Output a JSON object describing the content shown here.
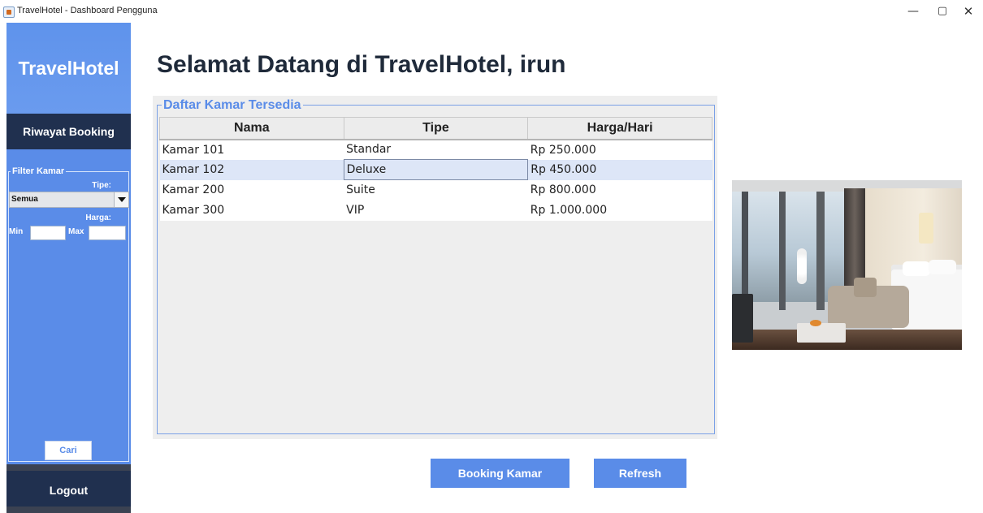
{
  "window": {
    "title": "TravelHotel - Dashboard Pengguna",
    "controls": {
      "minimize": "—",
      "maximize": "▢",
      "close": "✕"
    }
  },
  "sidebar": {
    "brand": "TravelHotel",
    "riwayat_label": "Riwayat Booking",
    "filter": {
      "legend": "Filter Kamar",
      "tipe_label": "Tipe:",
      "tipe_value": "Semua",
      "harga_label": "Harga:",
      "min_label": "Min",
      "min_value": "",
      "max_label": "Max",
      "max_value": "",
      "cari_label": "Cari"
    },
    "logout_label": "Logout"
  },
  "main": {
    "heading": "Selamat Datang di TravelHotel, irun",
    "panel_legend": "Daftar Kamar Tersedia",
    "table": {
      "columns": [
        "Nama",
        "Tipe",
        "Harga/Hari"
      ],
      "rows": [
        [
          "Kamar 101",
          "Standar",
          "Rp 250.000"
        ],
        [
          "Kamar 102",
          "Deluxe",
          "Rp 450.000"
        ],
        [
          "Kamar 200",
          "Suite",
          "Rp 800.000"
        ],
        [
          "Kamar 300",
          "VIP",
          "Rp 1.000.000"
        ]
      ],
      "selected_row": 1
    },
    "buttons": {
      "booking": "Booking Kamar",
      "refresh": "Refresh"
    }
  },
  "colors": {
    "accent": "#5a8ce8",
    "sidebar_dark": "#20304f",
    "selected_row": "#dde6f7"
  }
}
